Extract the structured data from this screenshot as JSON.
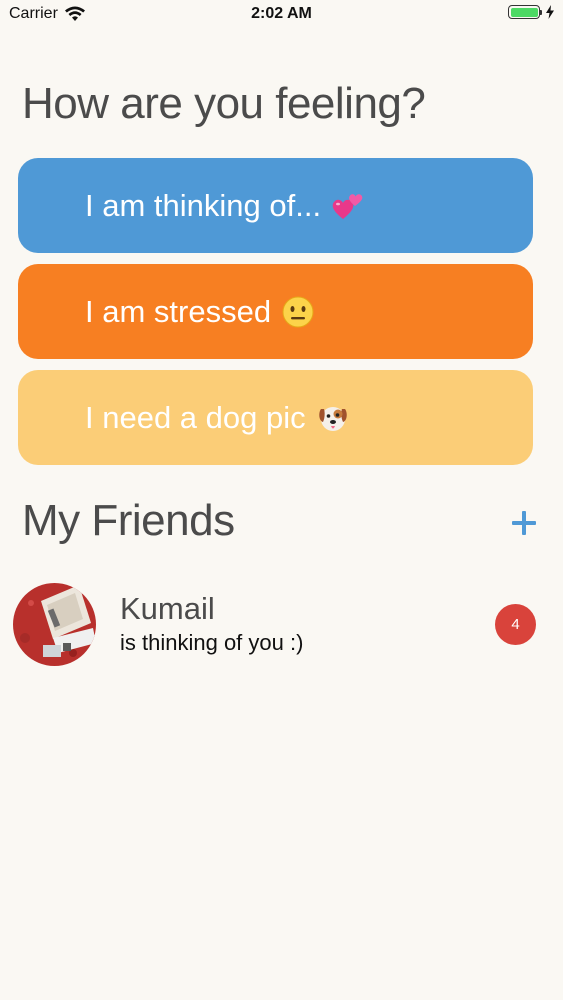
{
  "status_bar": {
    "carrier": "Carrier",
    "time": "2:02 AM",
    "battery_level": 1.0,
    "wifi_icon": "wifi-icon",
    "charging_icon": "bolt-icon"
  },
  "feeling": {
    "title": "How are you feeling?",
    "buttons": [
      {
        "label": "I am thinking of...",
        "emoji_icon": "two-hearts-icon",
        "color": "#4f99d6"
      },
      {
        "label": "I am stressed",
        "emoji_icon": "neutral-face-icon",
        "color": "#f77f22"
      },
      {
        "label": "I need a dog pic",
        "emoji_icon": "dog-face-icon",
        "color": "#fbcd77"
      }
    ]
  },
  "friends": {
    "title": "My Friends",
    "add_icon": "plus-icon",
    "accent_color": "#4f99d6",
    "list": [
      {
        "name": "Kumail",
        "status": "is thinking of you :)",
        "badge": "4",
        "badge_color": "#d9433b"
      }
    ]
  }
}
